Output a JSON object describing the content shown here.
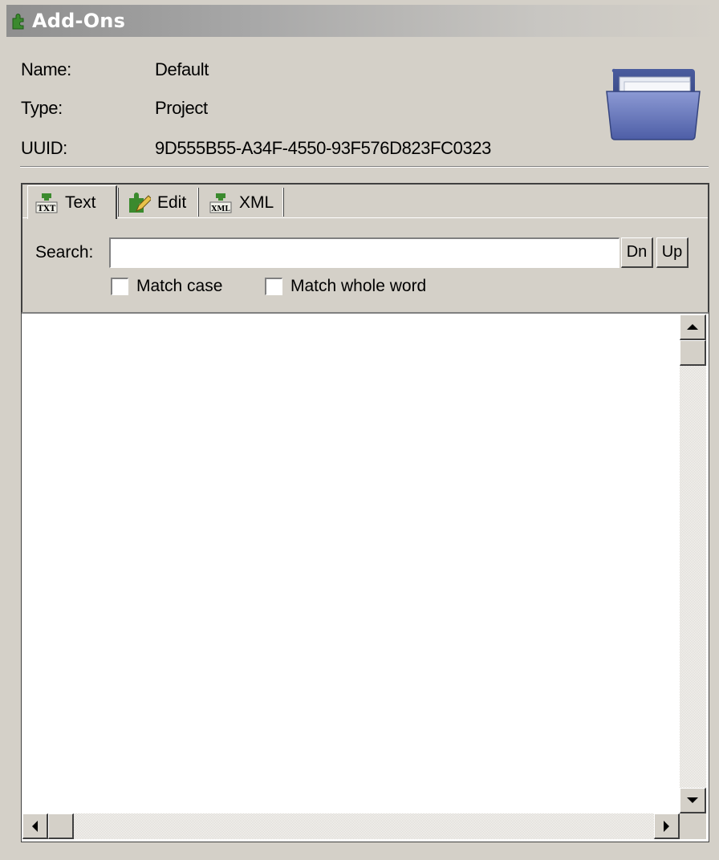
{
  "window": {
    "title": "Add-Ons",
    "title_icon": "puzzle-icon"
  },
  "info": {
    "name_label": "Name:",
    "name_value": "Default",
    "type_label": "Type:",
    "type_value": "Project",
    "uuid_label": "UUID:",
    "uuid_value": "9D555B55-A34F-4550-93F576D823FC0323",
    "icon": "folder-icon"
  },
  "tabs": [
    {
      "label": "Text",
      "icon": "text-file-icon",
      "active": true
    },
    {
      "label": "Edit",
      "icon": "edit-pencil-icon",
      "active": false
    },
    {
      "label": "XML",
      "icon": "xml-file-icon",
      "active": false
    }
  ],
  "search": {
    "label": "Search:",
    "value": "",
    "placeholder": "",
    "down_label": "Dn",
    "up_label": "Up",
    "match_case_label": "Match case",
    "match_case_checked": false,
    "match_whole_word_label": "Match whole word",
    "match_whole_word_checked": false
  },
  "editor": {
    "content": ""
  },
  "colors": {
    "face": "#d4d0c8",
    "shadow": "#808080",
    "dark_shadow": "#404040",
    "highlight": "#ffffff",
    "icon_green": "#3b8a2e"
  }
}
